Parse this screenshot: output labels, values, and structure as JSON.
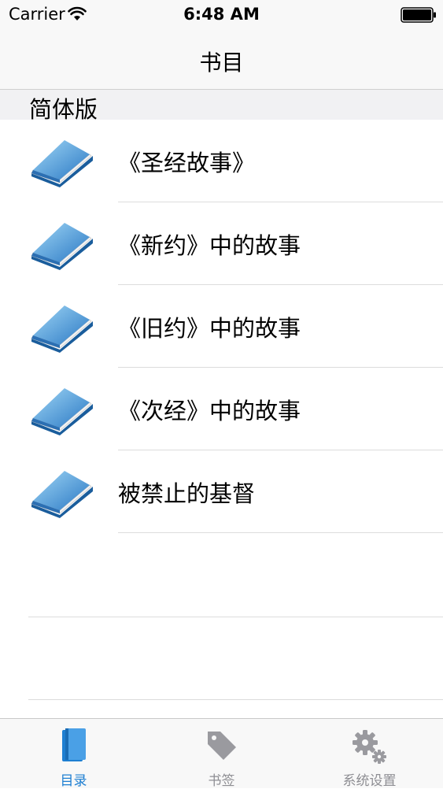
{
  "status_bar": {
    "carrier": "Carrier",
    "time": "6:48 AM"
  },
  "nav": {
    "title": "书目"
  },
  "section": {
    "title": "简体版"
  },
  "books": [
    {
      "title": "《圣经故事》"
    },
    {
      "title": "《新约》中的故事"
    },
    {
      "title": "《旧约》中的故事"
    },
    {
      "title": "《次经》中的故事"
    },
    {
      "title": "被禁止的基督"
    }
  ],
  "tabs": [
    {
      "label": "目录",
      "icon": "book-icon",
      "selected": true
    },
    {
      "label": "书签",
      "icon": "tag-icon",
      "selected": false
    },
    {
      "label": "系统设置",
      "icon": "gear-icon",
      "selected": false
    }
  ],
  "colors": {
    "accent": "#1e7fd2",
    "inactive": "#8e8e93"
  }
}
